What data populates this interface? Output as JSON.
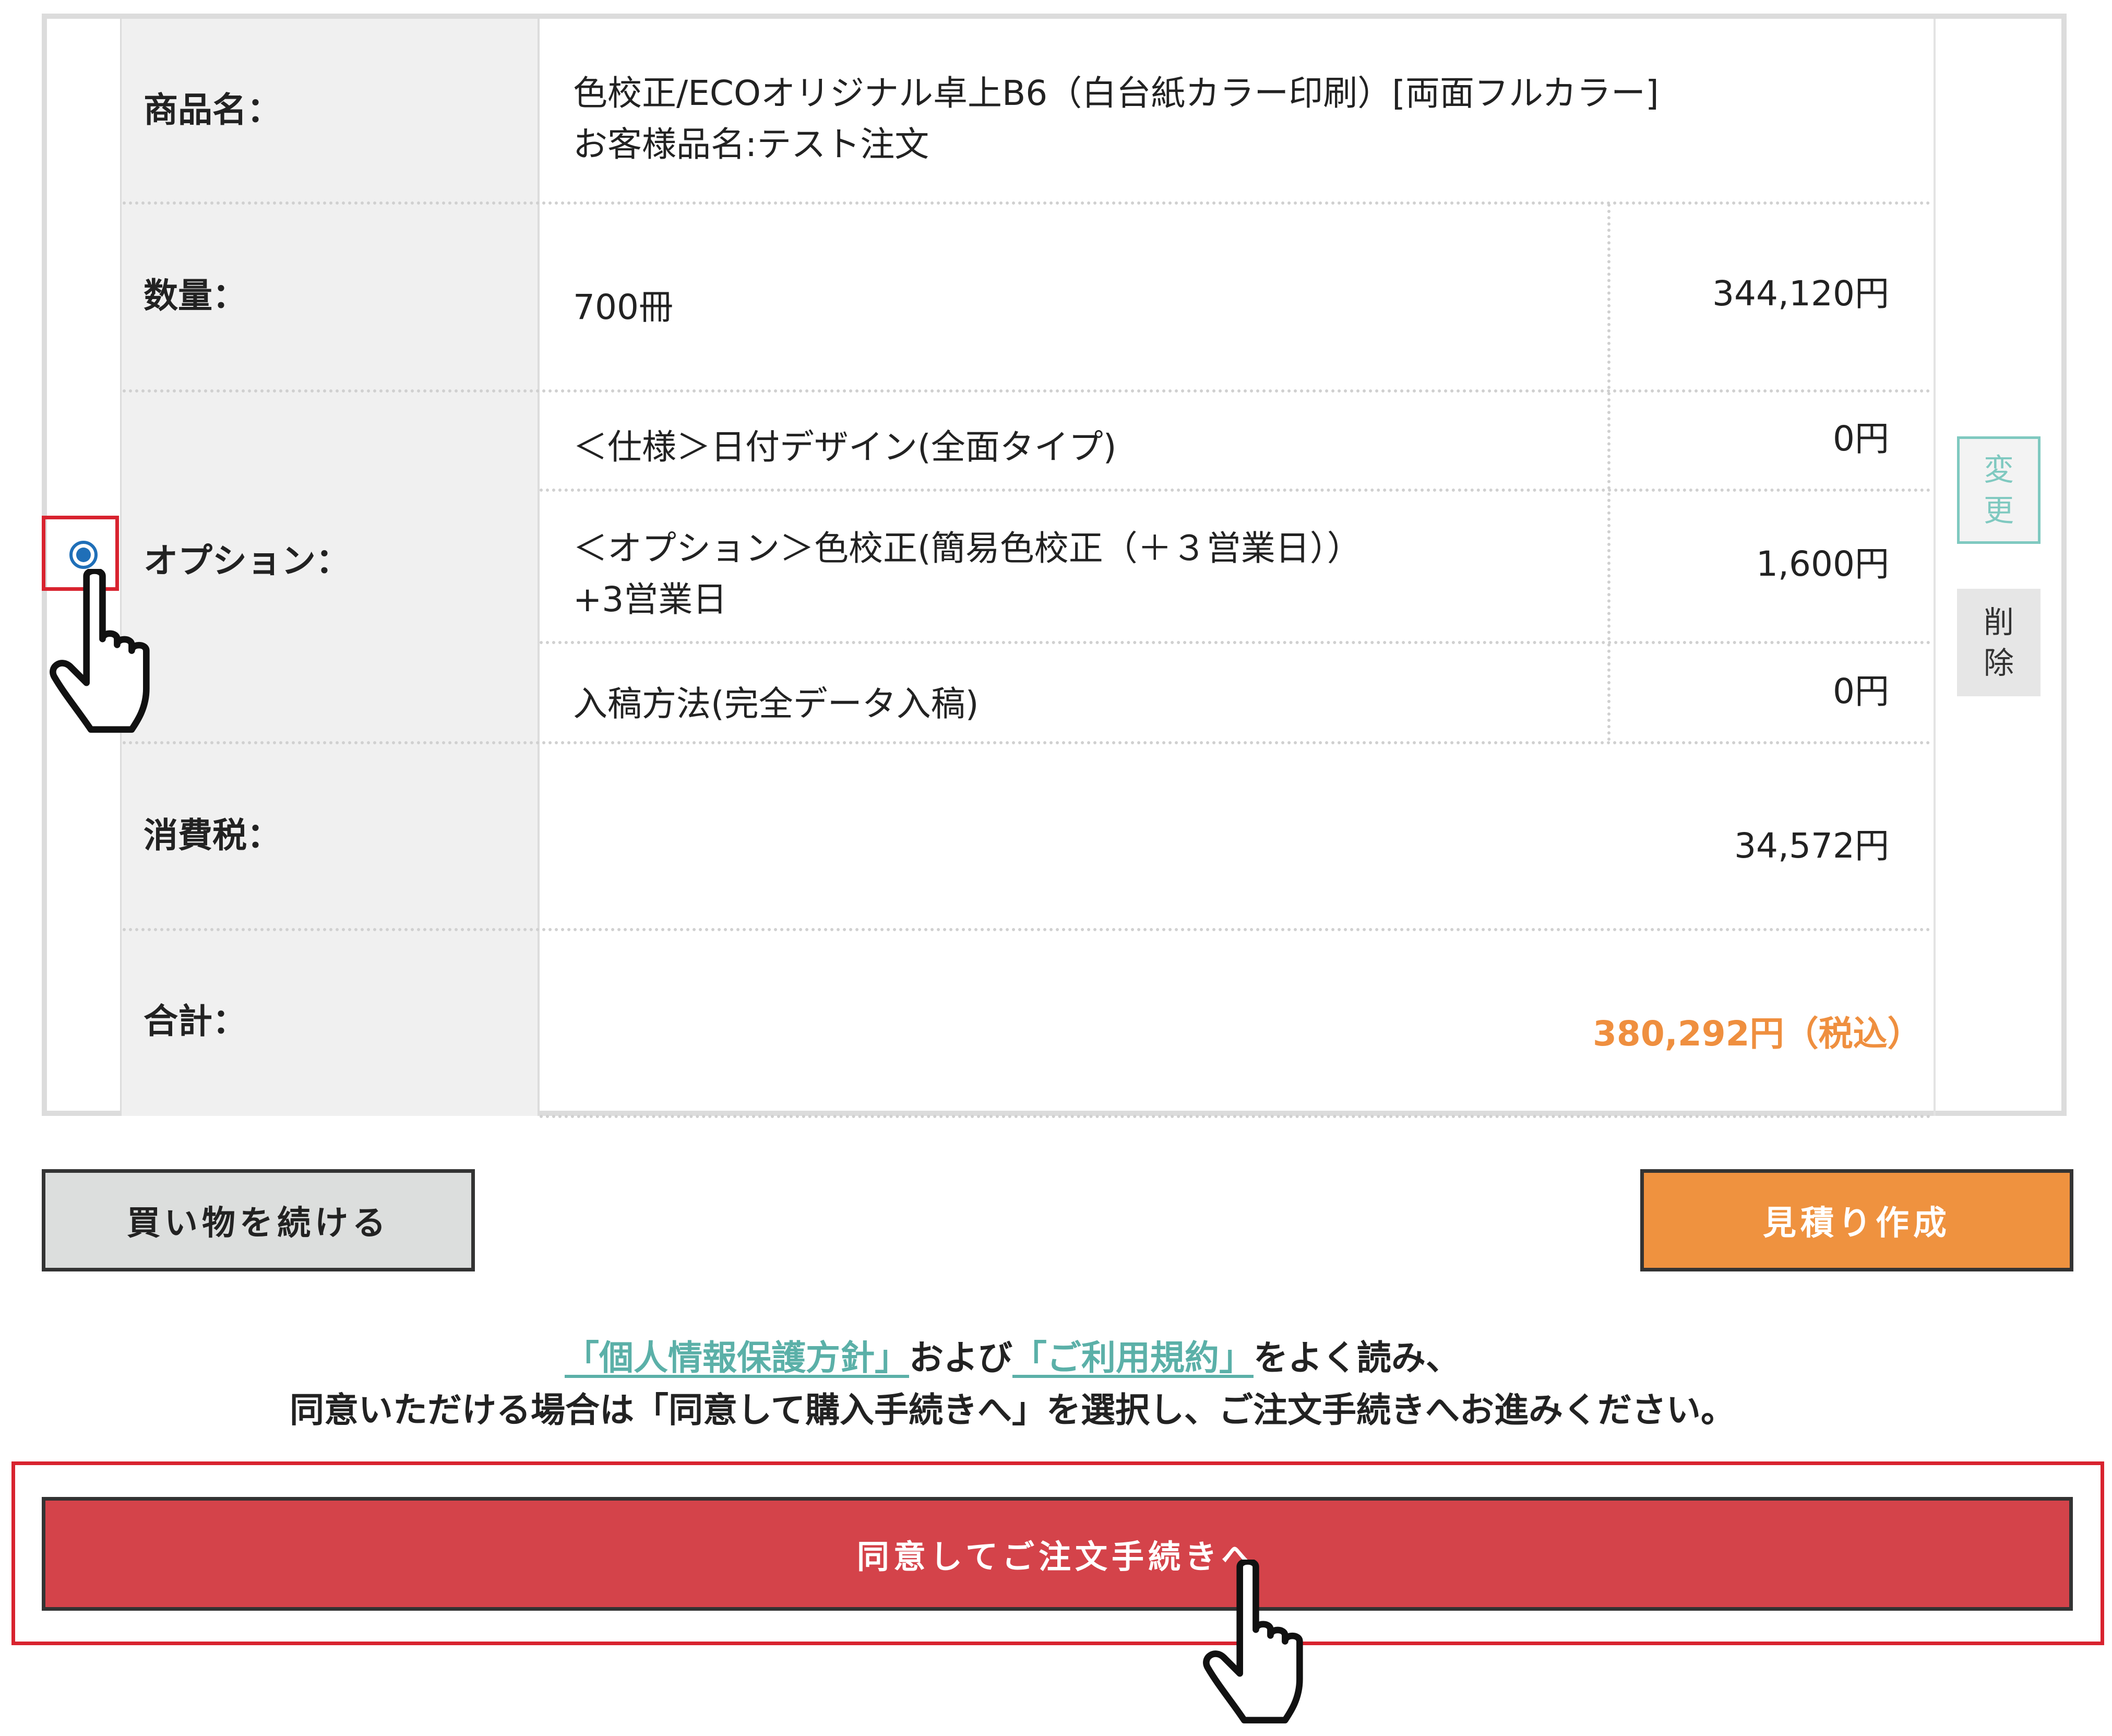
{
  "rows": {
    "product": {
      "label": "商品名：",
      "line1": "色校正/ECOオリジナル卓上B6（白台紙カラー印刷）[両面フルカラー]",
      "line2": "お客様品名:テスト注文"
    },
    "quantity": {
      "label": "数量：",
      "value": "700冊",
      "price": "344,120円"
    },
    "options": {
      "label": "オプション：",
      "items": [
        {
          "line1": "＜仕様＞日付デザイン(全面タイプ)",
          "line2": "",
          "price": "0円"
        },
        {
          "line1": "＜オプション＞色校正(簡易色校正（＋３営業日））",
          "line2": "+3営業日",
          "price": "1,600円"
        },
        {
          "line1": "入稿方法(完全データ入稿)",
          "line2": "",
          "price": "0円"
        }
      ]
    },
    "tax": {
      "label": "消費税：",
      "price": "34,572円"
    },
    "total": {
      "label": "合計：",
      "price": "380,292円（税込）"
    }
  },
  "actions": {
    "change": [
      "変",
      "更"
    ],
    "delete": [
      "削",
      "除"
    ]
  },
  "buttons": {
    "continue": "買い物を続ける",
    "estimate": "見積り作成",
    "agree": "同意してご注文手続きへ"
  },
  "notice": {
    "privacy_link": "「個人情報保護方針」",
    "and": "および",
    "terms_link": "「ご利用規約」",
    "read": "をよく読み、",
    "line2": "同意いただける場合は「同意して購入手続きへ」を選択し、ご注文手続きへお進みください。"
  },
  "colors": {
    "accent_orange": "#ef923f",
    "agree_red": "#d4434a",
    "highlight_red": "#d8232f",
    "link_teal": "#5bb0a8",
    "radio_blue": "#1f6fb8"
  }
}
